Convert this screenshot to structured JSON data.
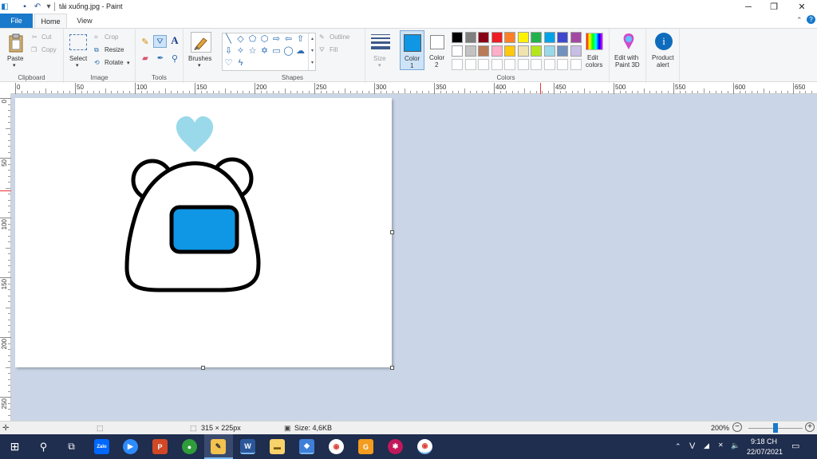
{
  "window": {
    "title": "tải xuống.jpg - Paint",
    "minimize_icon": "minimize-icon",
    "restore_icon": "restore-icon",
    "close_icon": "close-icon"
  },
  "tabs": {
    "file": "File",
    "home": "Home",
    "view": "View"
  },
  "clipboard": {
    "paste": "Paste",
    "cut": "Cut",
    "copy": "Copy",
    "group": "Clipboard"
  },
  "image": {
    "select": "Select",
    "crop": "Crop",
    "resize": "Resize",
    "rotate": "Rotate",
    "group": "Image"
  },
  "tools": {
    "group": "Tools"
  },
  "brushes": {
    "label": "Brushes"
  },
  "shapes": {
    "outline": "Outline",
    "fill": "Fill",
    "group": "Shapes"
  },
  "size": {
    "label": "Size"
  },
  "color1": {
    "label": "Color",
    "num": "1",
    "value": "#0f97e6"
  },
  "color2": {
    "label": "Color",
    "num": "2",
    "value": "#ffffff"
  },
  "colors": {
    "group": "Colors",
    "edit1": "Edit",
    "edit2": "colors",
    "row1": [
      "#000000",
      "#7f7f7f",
      "#880015",
      "#ed1c24",
      "#ff7f27",
      "#fff200",
      "#22b14c",
      "#00a2e8",
      "#3f48cc",
      "#a349a4"
    ],
    "row2": [
      "#ffffff",
      "#c3c3c3",
      "#b97a57",
      "#ffaec9",
      "#ffc90e",
      "#efe4b0",
      "#b5e61d",
      "#99d9ea",
      "#7092be",
      "#c8bfe7"
    ],
    "row3": [
      "#ffffff",
      "#ffffff",
      "#ffffff",
      "#ffffff",
      "#ffffff",
      "#ffffff",
      "#ffffff",
      "#ffffff",
      "#ffffff",
      "#ffffff"
    ]
  },
  "paint3d": {
    "line1": "Edit with",
    "line2": "Paint 3D"
  },
  "product": {
    "line1": "Product",
    "line2": "alert"
  },
  "hruler": [
    "0",
    "50",
    "100",
    "150",
    "200",
    "250",
    "300",
    "350",
    "400",
    "450",
    "500",
    "550",
    "600",
    "650"
  ],
  "vruler": [
    "0",
    "50",
    "100",
    "150",
    "200",
    "250"
  ],
  "status": {
    "dimensions": "315 × 225px",
    "size": "Size: 4,6KB",
    "zoom": "200%"
  },
  "taskbar": {
    "apps": [
      "start-icon",
      "search-icon",
      "task-view-icon",
      "zalo-icon",
      "zoom-icon",
      "powerpoint-icon",
      "camtasia-icon",
      "paint-icon",
      "word-icon",
      "file-explorer-icon",
      "app-icon",
      "chrome-icon",
      "app2-icon",
      "app3-icon",
      "chrome2-icon"
    ],
    "zalo": "Zalo",
    "tray_lang": "V",
    "time": "9:18 CH",
    "date": "22/07/2021"
  }
}
